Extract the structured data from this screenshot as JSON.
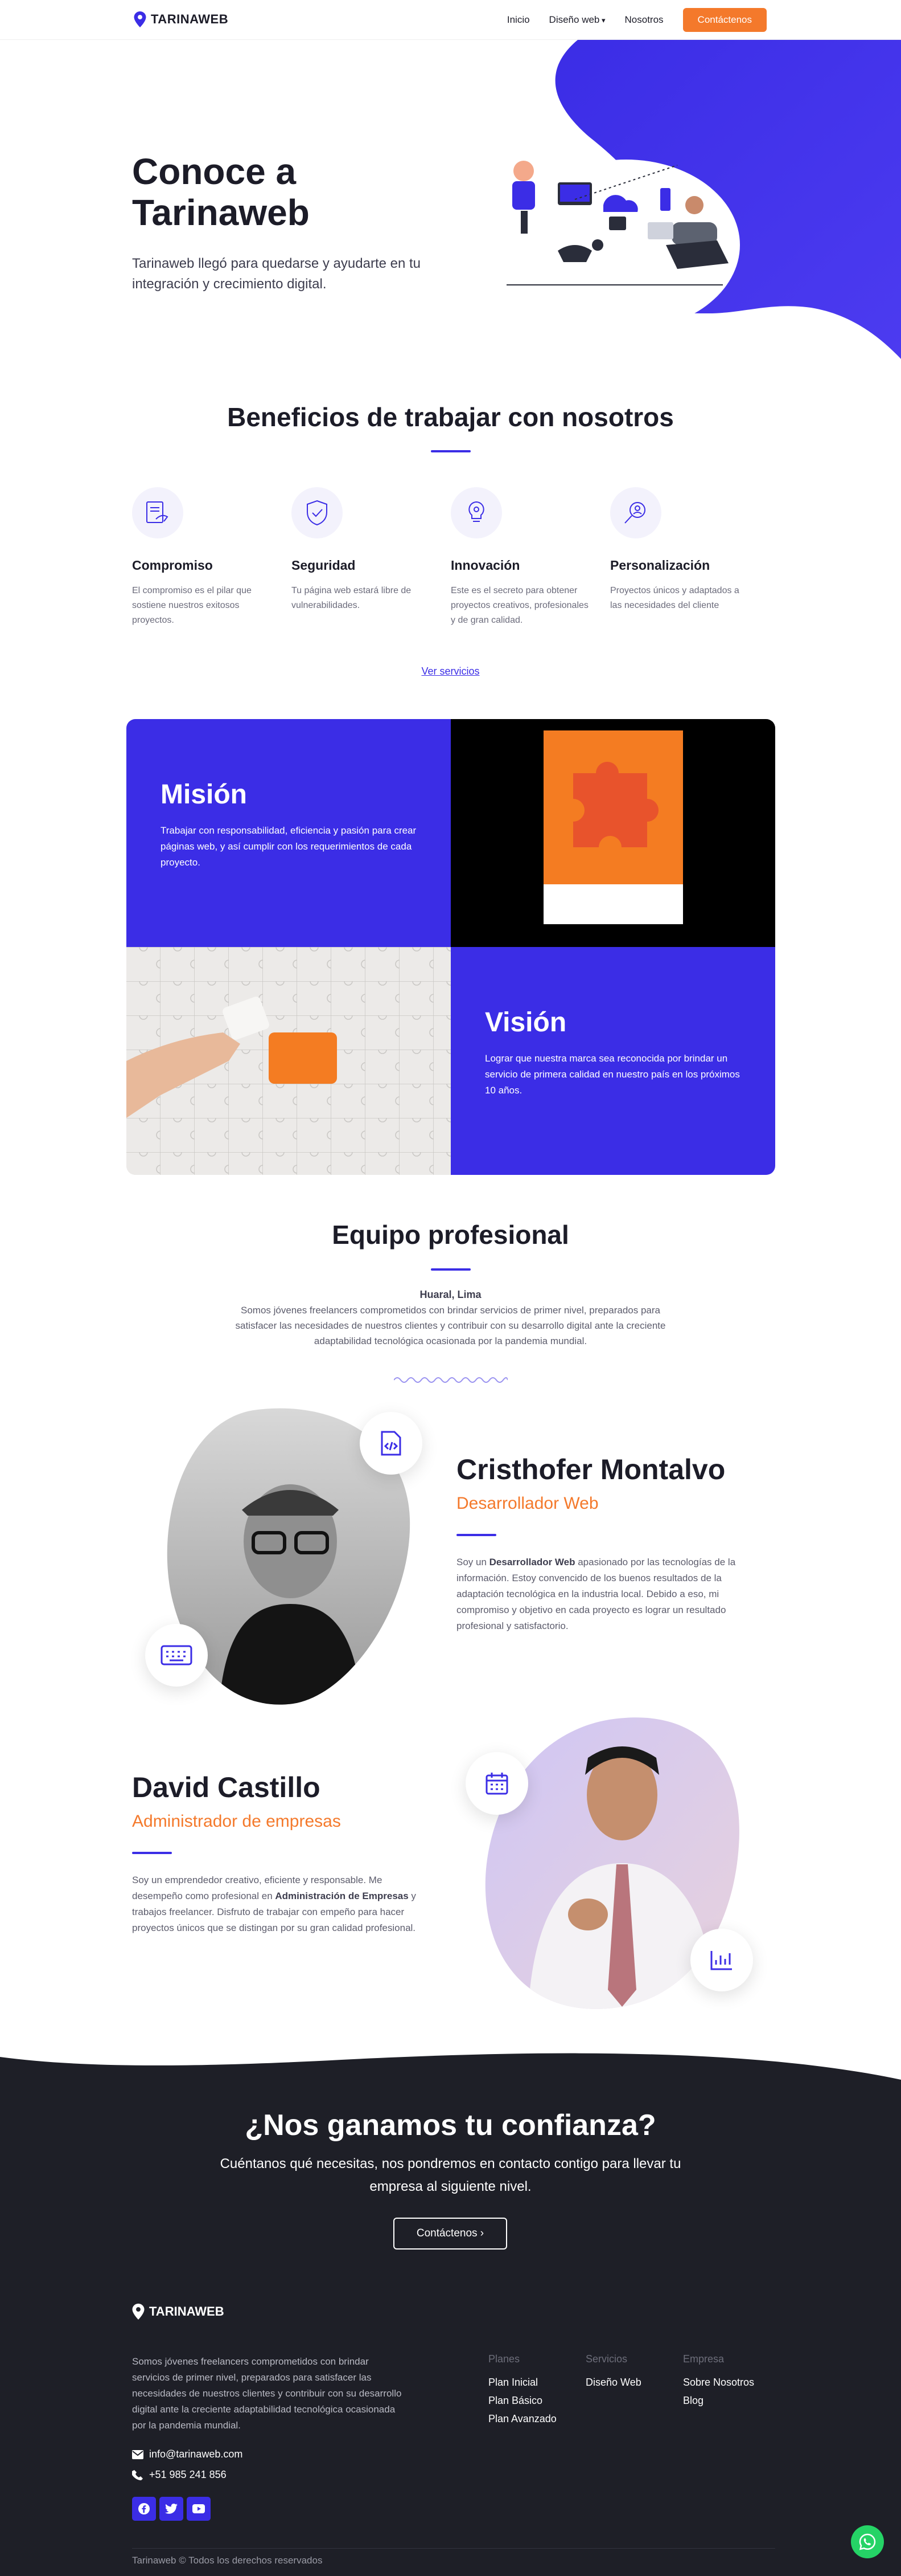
{
  "nav": {
    "brand": "TARINAWEB",
    "links": [
      "Inicio",
      "Diseño web",
      "Nosotros"
    ],
    "cta": "Contáctenos"
  },
  "hero": {
    "title_line1": "Conoce a",
    "title_line2": "Tarinaweb",
    "subtitle": "Tarinaweb llegó para quedarse y ayudarte en tu integración y crecimiento digital."
  },
  "benefits": {
    "title": "Beneficios de trabajar con nosotros",
    "items": [
      {
        "icon": "contract-icon",
        "title": "Compromiso",
        "text": "El compromiso es el pilar que sostiene nuestros exitosos proyectos."
      },
      {
        "icon": "shield-check-icon",
        "title": "Seguridad",
        "text": "Tu página web estará libre de vulnerabilidades."
      },
      {
        "icon": "lightbulb-gear-icon",
        "title": "Innovación",
        "text": "Este es el secreto para obtener proyectos creativos, profesionales y de gran calidad."
      },
      {
        "icon": "search-user-icon",
        "title": "Personalización",
        "text": "Proyectos únicos y adaptados a las necesidades del cliente"
      }
    ],
    "link": "Ver servicios"
  },
  "mission": {
    "title": "Misión",
    "text": "Trabajar con responsabilidad, eficiencia y pasión para crear páginas web, y así cumplir con los requerimientos de cada proyecto."
  },
  "vision": {
    "title": "Visión",
    "text": "Lograr que nuestra marca sea reconocida por brindar un servicio de primera calidad en nuestro país en los próximos 10 años."
  },
  "team": {
    "title": "Equipo profesional",
    "location": "Huaral, Lima",
    "description": "Somos jóvenes freelancers comprometidos con brindar servicios de primer nivel, preparados para satisfacer las necesidades de nuestros clientes y contribuir con su desarrollo digital ante la creciente adaptabilidad tecnológica ocasionada por la pandemia mundial.",
    "members": [
      {
        "name": "Cristhofer Montalvo",
        "role": "Desarrollador Web",
        "text_a": "Soy un ",
        "text_b": "Desarrollador Web",
        "text_c": " apasionado por las tecnologías de la información. Estoy convencido de los buenos resultados de la adaptación tecnológica en la industria local. Debido a eso, mi compromiso y objetivo en cada proyecto es lograr un resultado profesional y satisfactorio."
      },
      {
        "name": "David Castillo",
        "role": "Administrador de empresas",
        "text_a": "Soy un emprendedor creativo, eficiente y responsable. Me desempeño como profesional en ",
        "text_b": "Administración de Empresas",
        "text_c": " y trabajos freelancer. Disfruto de trabajar con empeño para hacer proyectos únicos que se distingan por su gran calidad profesional."
      }
    ]
  },
  "cta": {
    "title": "¿Nos ganamos tu confianza?",
    "subtitle": "Cuéntanos qué necesitas, nos pondremos en contacto contigo para llevar tu empresa al siguiente nivel.",
    "button": "Contáctenos ›"
  },
  "footer": {
    "brand": "TARINAWEB",
    "about": "Somos jóvenes freelancers comprometidos con brindar servicios de primer nivel, preparados para satisfacer las necesidades de nuestros clientes y contribuir con su desarrollo digital ante la creciente adaptabilidad tecnológica ocasionada por la pandemia mundial.",
    "email": "info@tarinaweb.com",
    "phone": "+51 985 241 856",
    "columns": [
      {
        "title": "Planes",
        "links": [
          "Plan Inicial",
          "Plan Básico",
          "Plan Avanzado"
        ]
      },
      {
        "title": "Servicios",
        "links": [
          "Diseño Web"
        ]
      },
      {
        "title": "Empresa",
        "links": [
          "Sobre Nosotros",
          "Blog"
        ]
      }
    ],
    "copyright": "Tarinaweb © Todos los derechos reservados"
  },
  "colors": {
    "accent": "#3b2de6",
    "orange": "#f4792b",
    "dark": "#1e1f27",
    "whatsapp": "#25d366"
  }
}
